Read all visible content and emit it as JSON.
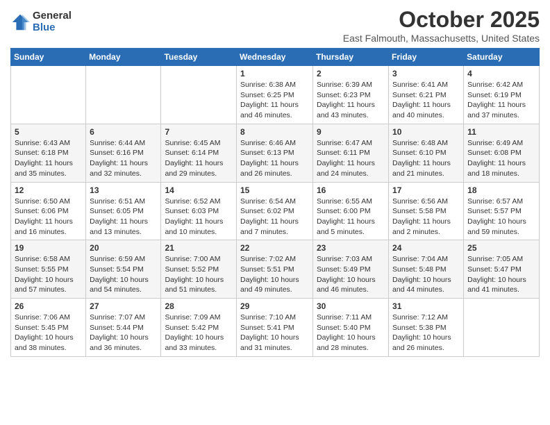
{
  "logo": {
    "general": "General",
    "blue": "Blue"
  },
  "header": {
    "month": "October 2025",
    "location": "East Falmouth, Massachusetts, United States"
  },
  "days_of_week": [
    "Sunday",
    "Monday",
    "Tuesday",
    "Wednesday",
    "Thursday",
    "Friday",
    "Saturday"
  ],
  "weeks": [
    [
      {
        "day": "",
        "info": ""
      },
      {
        "day": "",
        "info": ""
      },
      {
        "day": "",
        "info": ""
      },
      {
        "day": "1",
        "info": "Sunrise: 6:38 AM\nSunset: 6:25 PM\nDaylight: 11 hours and 46 minutes."
      },
      {
        "day": "2",
        "info": "Sunrise: 6:39 AM\nSunset: 6:23 PM\nDaylight: 11 hours and 43 minutes."
      },
      {
        "day": "3",
        "info": "Sunrise: 6:41 AM\nSunset: 6:21 PM\nDaylight: 11 hours and 40 minutes."
      },
      {
        "day": "4",
        "info": "Sunrise: 6:42 AM\nSunset: 6:19 PM\nDaylight: 11 hours and 37 minutes."
      }
    ],
    [
      {
        "day": "5",
        "info": "Sunrise: 6:43 AM\nSunset: 6:18 PM\nDaylight: 11 hours and 35 minutes."
      },
      {
        "day": "6",
        "info": "Sunrise: 6:44 AM\nSunset: 6:16 PM\nDaylight: 11 hours and 32 minutes."
      },
      {
        "day": "7",
        "info": "Sunrise: 6:45 AM\nSunset: 6:14 PM\nDaylight: 11 hours and 29 minutes."
      },
      {
        "day": "8",
        "info": "Sunrise: 6:46 AM\nSunset: 6:13 PM\nDaylight: 11 hours and 26 minutes."
      },
      {
        "day": "9",
        "info": "Sunrise: 6:47 AM\nSunset: 6:11 PM\nDaylight: 11 hours and 24 minutes."
      },
      {
        "day": "10",
        "info": "Sunrise: 6:48 AM\nSunset: 6:10 PM\nDaylight: 11 hours and 21 minutes."
      },
      {
        "day": "11",
        "info": "Sunrise: 6:49 AM\nSunset: 6:08 PM\nDaylight: 11 hours and 18 minutes."
      }
    ],
    [
      {
        "day": "12",
        "info": "Sunrise: 6:50 AM\nSunset: 6:06 PM\nDaylight: 11 hours and 16 minutes."
      },
      {
        "day": "13",
        "info": "Sunrise: 6:51 AM\nSunset: 6:05 PM\nDaylight: 11 hours and 13 minutes."
      },
      {
        "day": "14",
        "info": "Sunrise: 6:52 AM\nSunset: 6:03 PM\nDaylight: 11 hours and 10 minutes."
      },
      {
        "day": "15",
        "info": "Sunrise: 6:54 AM\nSunset: 6:02 PM\nDaylight: 11 hours and 7 minutes."
      },
      {
        "day": "16",
        "info": "Sunrise: 6:55 AM\nSunset: 6:00 PM\nDaylight: 11 hours and 5 minutes."
      },
      {
        "day": "17",
        "info": "Sunrise: 6:56 AM\nSunset: 5:58 PM\nDaylight: 11 hours and 2 minutes."
      },
      {
        "day": "18",
        "info": "Sunrise: 6:57 AM\nSunset: 5:57 PM\nDaylight: 10 hours and 59 minutes."
      }
    ],
    [
      {
        "day": "19",
        "info": "Sunrise: 6:58 AM\nSunset: 5:55 PM\nDaylight: 10 hours and 57 minutes."
      },
      {
        "day": "20",
        "info": "Sunrise: 6:59 AM\nSunset: 5:54 PM\nDaylight: 10 hours and 54 minutes."
      },
      {
        "day": "21",
        "info": "Sunrise: 7:00 AM\nSunset: 5:52 PM\nDaylight: 10 hours and 51 minutes."
      },
      {
        "day": "22",
        "info": "Sunrise: 7:02 AM\nSunset: 5:51 PM\nDaylight: 10 hours and 49 minutes."
      },
      {
        "day": "23",
        "info": "Sunrise: 7:03 AM\nSunset: 5:49 PM\nDaylight: 10 hours and 46 minutes."
      },
      {
        "day": "24",
        "info": "Sunrise: 7:04 AM\nSunset: 5:48 PM\nDaylight: 10 hours and 44 minutes."
      },
      {
        "day": "25",
        "info": "Sunrise: 7:05 AM\nSunset: 5:47 PM\nDaylight: 10 hours and 41 minutes."
      }
    ],
    [
      {
        "day": "26",
        "info": "Sunrise: 7:06 AM\nSunset: 5:45 PM\nDaylight: 10 hours and 38 minutes."
      },
      {
        "day": "27",
        "info": "Sunrise: 7:07 AM\nSunset: 5:44 PM\nDaylight: 10 hours and 36 minutes."
      },
      {
        "day": "28",
        "info": "Sunrise: 7:09 AM\nSunset: 5:42 PM\nDaylight: 10 hours and 33 minutes."
      },
      {
        "day": "29",
        "info": "Sunrise: 7:10 AM\nSunset: 5:41 PM\nDaylight: 10 hours and 31 minutes."
      },
      {
        "day": "30",
        "info": "Sunrise: 7:11 AM\nSunset: 5:40 PM\nDaylight: 10 hours and 28 minutes."
      },
      {
        "day": "31",
        "info": "Sunrise: 7:12 AM\nSunset: 5:38 PM\nDaylight: 10 hours and 26 minutes."
      },
      {
        "day": "",
        "info": ""
      }
    ]
  ]
}
